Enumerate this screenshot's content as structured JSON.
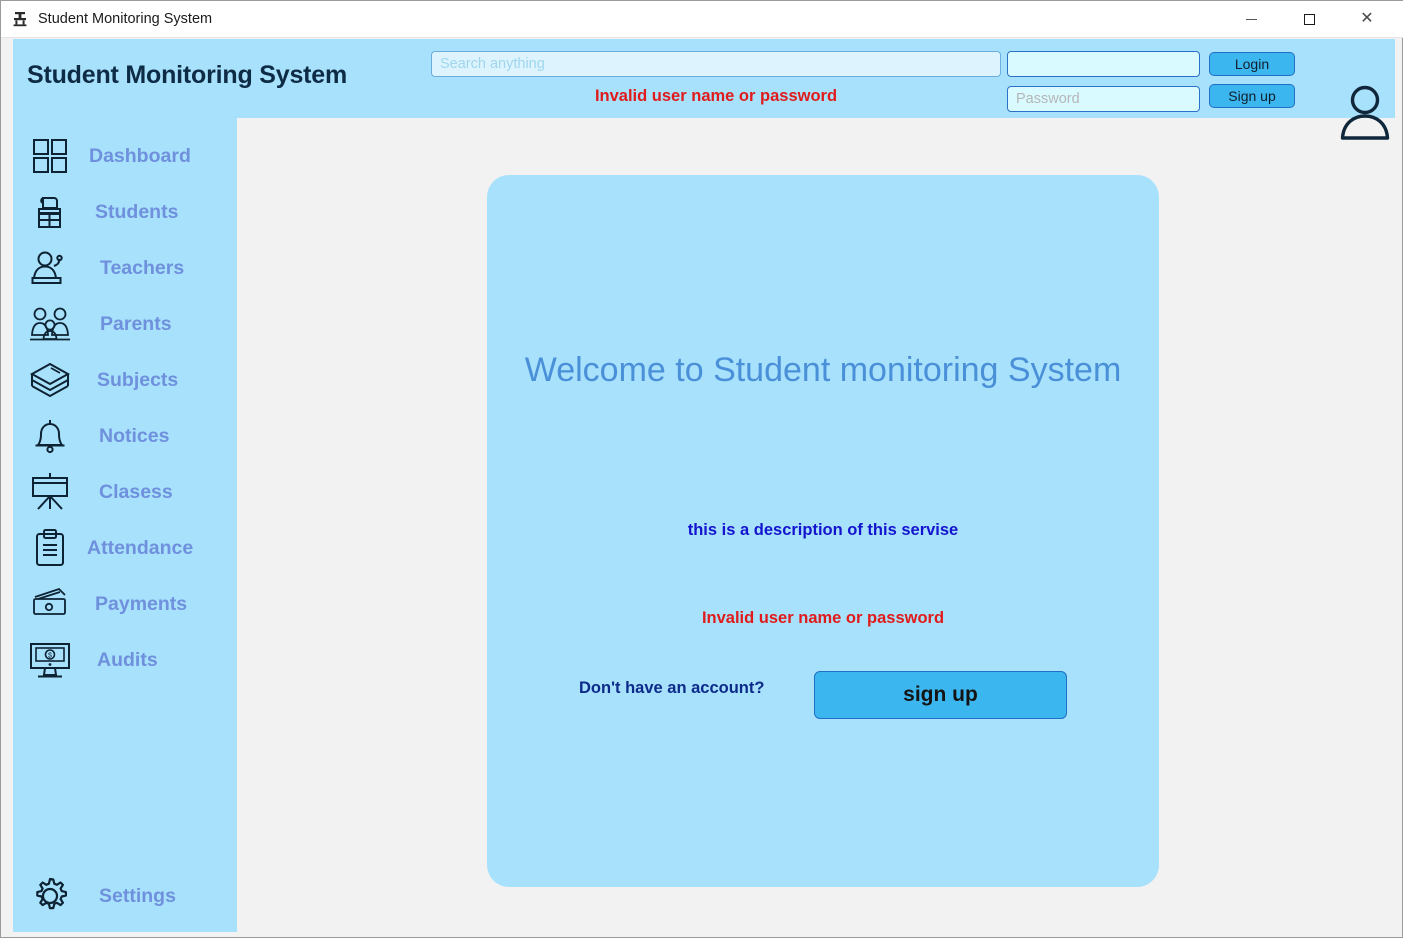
{
  "window": {
    "title": "Student Monitoring System",
    "icon": "app-icon",
    "minimize_label": "",
    "maximize_label": "",
    "close_label": "✕"
  },
  "header": {
    "brand": "Student Monitoring System",
    "search": {
      "placeholder": "Search anything",
      "value": ""
    },
    "error_message": "Invalid user name or password",
    "username": {
      "placeholder": "",
      "value": ""
    },
    "password": {
      "placeholder": "Password",
      "value": ""
    },
    "login_label": "Login",
    "signup_label": "Sign up",
    "avatar_icon": "user-avatar-icon",
    "background": "#a8e1fb",
    "button_color": "#3cb6ee"
  },
  "sidebar": {
    "background": "#a8e1fb",
    "label_color": "#6f91dd",
    "items": [
      {
        "label": "Dashboard",
        "icon": "dashboard-grid-icon"
      },
      {
        "label": "Students",
        "icon": "student-icon"
      },
      {
        "label": "Teachers",
        "icon": "teacher-podium-icon"
      },
      {
        "label": "Parents",
        "icon": "family-icon"
      },
      {
        "label": "Subjects",
        "icon": "books-stack-icon"
      },
      {
        "label": "Notices",
        "icon": "bell-icon"
      },
      {
        "label": "Clasess",
        "icon": "whiteboard-easel-icon"
      },
      {
        "label": "Attendance",
        "icon": "clipboard-icon"
      },
      {
        "label": "Payments",
        "icon": "wallet-money-icon"
      },
      {
        "label": "Audits",
        "icon": "monitor-money-icon"
      }
    ],
    "footer": {
      "label": "Settings",
      "icon": "gear-icon"
    }
  },
  "main": {
    "card": {
      "title": "Welcome to Student monitoring System",
      "description": "this is a description of this servise",
      "error_message": "Invalid user name or password",
      "signup_prompt": "Don't have an account?",
      "signup_button": "sign up",
      "background": "#a8e1fb"
    },
    "content_background": "#f2f2f2"
  }
}
